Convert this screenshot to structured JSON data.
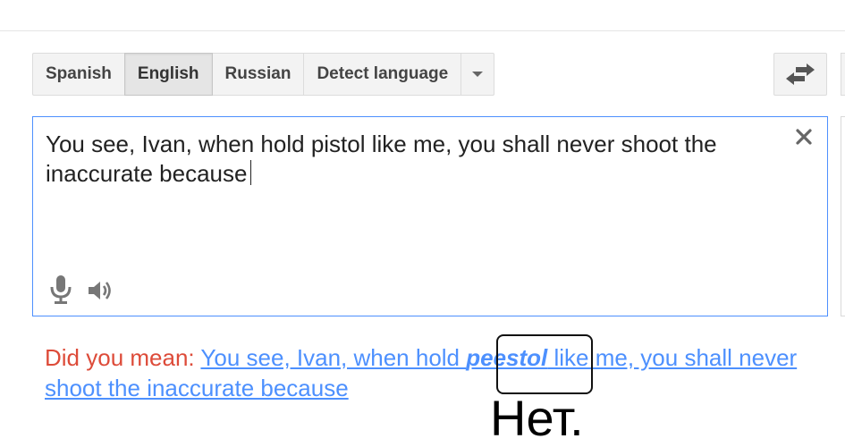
{
  "source_languages": [
    {
      "label": "Spanish",
      "selected": false
    },
    {
      "label": "English",
      "selected": true
    },
    {
      "label": "Russian",
      "selected": false
    },
    {
      "label": "Detect language",
      "selected": false
    }
  ],
  "icons": {
    "dropdown": "chevron-down-icon",
    "swap": "swap-languages-icon",
    "clear": "close-icon",
    "mic": "microphone-icon",
    "listen": "speaker-icon"
  },
  "source": {
    "text": "You see, Ivan, when hold pistol like me, you shall never shoot the inaccurate because"
  },
  "suggestion": {
    "prefix": "Did you mean:",
    "before": "You see, Ivan, when hold ",
    "corrected_word": "peestol",
    "after": " like me, you shall never shoot the inaccurate because"
  },
  "annotation": {
    "caption": "Нет."
  },
  "colors": {
    "accent_blue": "#4d90fe",
    "suggestion_red": "#dd4b39",
    "button_bg": "#f3f3f3"
  }
}
